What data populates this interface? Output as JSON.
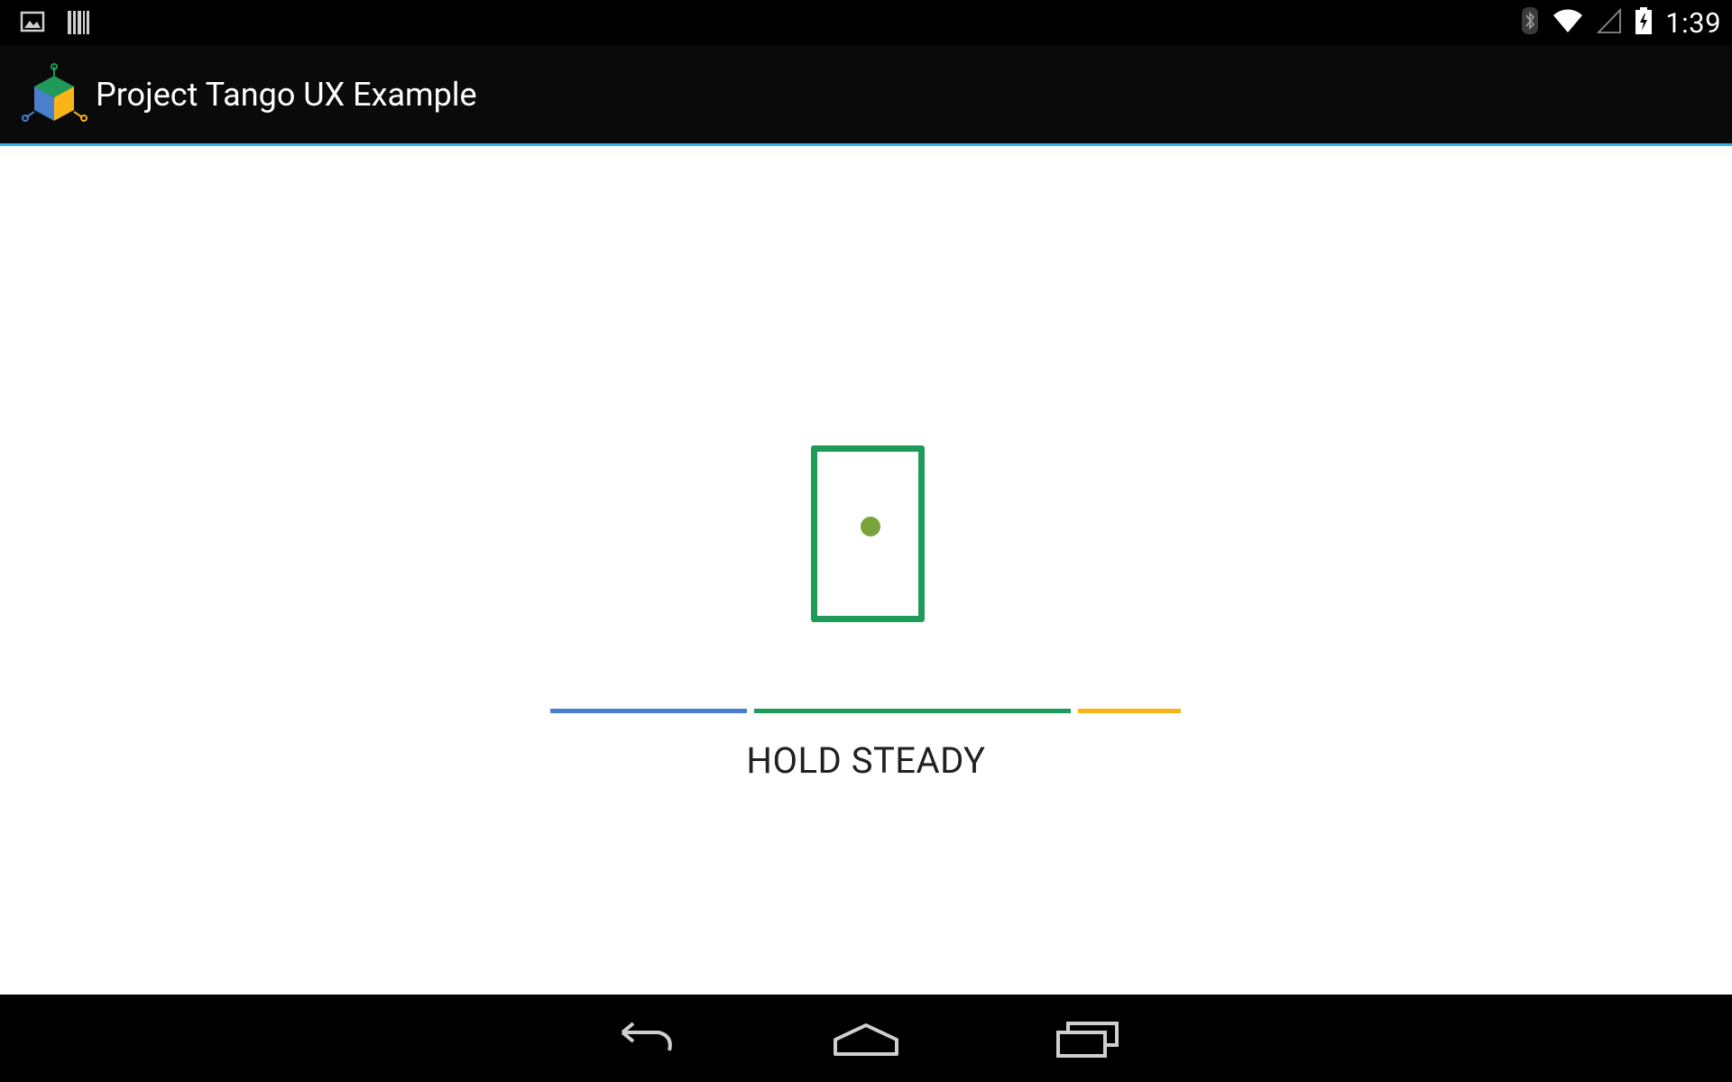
{
  "status_bar": {
    "time": "1:39",
    "left_icons": [
      "image-notification-icon",
      "barcode-notification-icon"
    ],
    "right_icons": [
      "bluetooth-icon",
      "wifi-icon",
      "cell-signal-icon",
      "battery-charging-icon"
    ]
  },
  "action_bar": {
    "title": "Project Tango UX Example",
    "app_icon": "tango-cube-icon"
  },
  "main": {
    "instruction": "HOLD STEADY",
    "progress_segments": [
      {
        "color": "#4a7fcb"
      },
      {
        "color": "#1e9b59"
      },
      {
        "color": "#f9b517"
      }
    ],
    "device_icon": "device-outline-icon"
  },
  "nav_bar": {
    "buttons": [
      "back-button",
      "home-button",
      "recents-button"
    ]
  },
  "colors": {
    "accent": "#33b5e5",
    "green": "#1e9b59",
    "dot": "#79a43c"
  }
}
